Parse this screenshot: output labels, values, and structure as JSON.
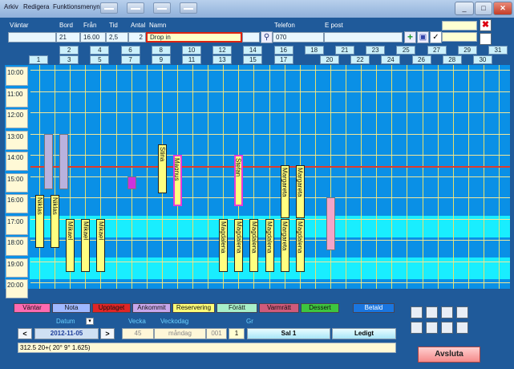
{
  "menu": [
    "Arkiv",
    "Redigera",
    "Funktionsmenyn"
  ],
  "header_labels": {
    "wait": "Väntar",
    "table": "Bord",
    "from": "Från",
    "time": "Tid",
    "count": "Antal",
    "name": "Namn",
    "phone": "Telefon",
    "email": "E post"
  },
  "booking": {
    "table": "21",
    "from": "16.00",
    "time": "2,5",
    "count": "2",
    "name": "Drop in",
    "phone": "070",
    "email": ""
  },
  "col_even": [
    "2",
    "4",
    "6",
    "8",
    "10",
    "12",
    "14",
    "16",
    "18",
    "21",
    "23",
    "25",
    "27",
    "29",
    "31"
  ],
  "col_odd": [
    "1",
    "3",
    "5",
    "7",
    "9",
    "11",
    "13",
    "15",
    "17",
    "20",
    "22",
    "24",
    "26",
    "28",
    "30"
  ],
  "times": [
    "10:00",
    "11:00",
    "12:00",
    "13:00",
    "14:00",
    "15:00",
    "16:00",
    "17:00",
    "18:00",
    "19:00",
    "20:00"
  ],
  "reservations": [
    "Niklas",
    "Niklas",
    "Mikael",
    "Mikael",
    "Mikael",
    "Stina",
    "Magnus",
    "Magdalena",
    "Stefan",
    "Magdalena",
    "Magdalena",
    "Margareta",
    "Margareta",
    "Magdalena",
    "Margareta"
  ],
  "legend": [
    "Väntar",
    "Nota",
    "Upptaget",
    "Ankommit",
    "Reservering",
    "Förätt",
    "Varmrätt",
    "Dessert",
    "Betald"
  ],
  "bottom_labels": {
    "date": "Datum",
    "week": "Vecka",
    "weekday": "Veckodag",
    "group": "Gr"
  },
  "bottom": {
    "prev": "<",
    "date": "2012-11-05",
    "next": ">",
    "week": "45",
    "weekday": "måndag",
    "code": "001",
    "group": "1",
    "room": "Sal 1",
    "status": "Ledigt"
  },
  "status_text": "312.5 20+( 20° 9° 1.625)",
  "quit": "Avsluta",
  "colors": {
    "band": "#19eeff",
    "grid": "#0a90e6",
    "legend_upptaget": "#e02525",
    "legend_reservering": "#ffff77"
  }
}
